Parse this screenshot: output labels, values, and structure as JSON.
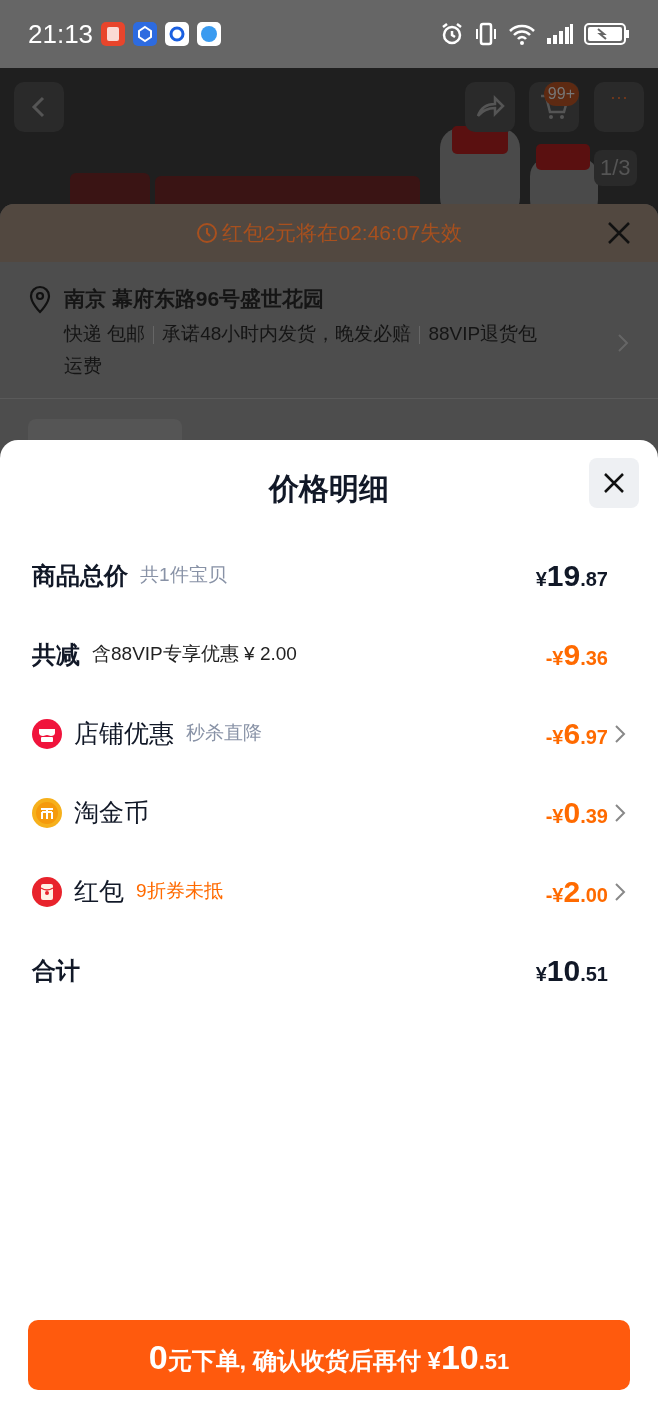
{
  "status_bar": {
    "time": "21:13"
  },
  "product_header": {
    "badge": "99+",
    "more": "···",
    "image_counter": "1/3"
  },
  "background_panel": {
    "countdown": "红包2元将在02:46:07失效",
    "address": "南京 幕府东路96号盛世花园",
    "delivery": [
      "快递 包邮",
      "承诺48小时内发货，晚发必赔",
      "88VIP退货包"
    ],
    "delivery_wrap": "运费"
  },
  "sheet": {
    "title": "价格明细",
    "rows": [
      {
        "kind": "subtotal",
        "label": "商品总价",
        "note": "共1件宝贝",
        "price": {
          "currency": "¥",
          "whole": "19",
          "fraction": ".87"
        }
      },
      {
        "kind": "reduction",
        "label": "共减",
        "note": "含88VIP专享优惠 ¥ 2.00",
        "price": {
          "sign": "-",
          "currency": "¥",
          "whole": "9",
          "fraction": ".36"
        }
      },
      {
        "kind": "shop",
        "label": "店铺优惠",
        "note": "秒杀直降",
        "price": {
          "sign": "-",
          "currency": "¥",
          "whole": "6",
          "fraction": ".97"
        }
      },
      {
        "kind": "coin",
        "label": "淘金币",
        "price": {
          "sign": "-",
          "currency": "¥",
          "whole": "0",
          "fraction": ".39"
        }
      },
      {
        "kind": "packet",
        "label": "红包",
        "note": "9折券未抵",
        "price": {
          "sign": "-",
          "currency": "¥",
          "whole": "2",
          "fraction": ".00"
        }
      },
      {
        "kind": "total",
        "label": "合计",
        "price": {
          "currency": "¥",
          "whole": "10",
          "fraction": ".51"
        }
      }
    ],
    "order_button": [
      {
        "text": "0",
        "kind": "figure"
      },
      {
        "text": "元下单, 确认收货后再付 ¥",
        "kind": "label"
      },
      {
        "text": "10",
        "kind": "figure"
      },
      {
        "text": ".51",
        "kind": "fraction"
      }
    ]
  }
}
